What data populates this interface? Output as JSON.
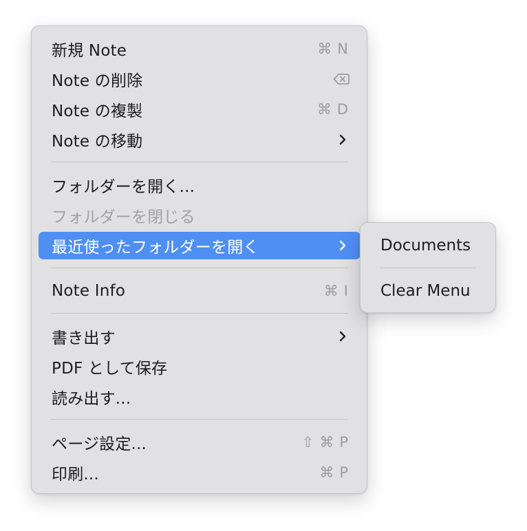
{
  "menu": {
    "items": {
      "new_note": {
        "label": "新規 Note",
        "shortcut_mod": "⌘",
        "shortcut_key": "N"
      },
      "delete_note": {
        "label": "Note の削除",
        "shortcut_icon": "delete-backward-icon"
      },
      "duplicate_note": {
        "label": "Note の複製",
        "shortcut_mod": "⌘",
        "shortcut_key": "D"
      },
      "move_note": {
        "label": "Note の移動",
        "submenu_icon": "chevron-right-icon"
      },
      "open_folder": {
        "label": "フォルダーを開く..."
      },
      "close_folder": {
        "label": "フォルダーを閉じる",
        "disabled": true
      },
      "recent_folders": {
        "label": "最近使ったフォルダーを開く",
        "submenu_icon": "chevron-right-icon",
        "highlighted": true
      },
      "note_info": {
        "label": "Note Info",
        "shortcut_mod": "⌘",
        "shortcut_key": "I"
      },
      "export": {
        "label": "書き出す",
        "submenu_icon": "chevron-right-icon"
      },
      "save_pdf": {
        "label": "PDF として保存"
      },
      "import": {
        "label": "読み出す..."
      },
      "page_setup": {
        "label": "ページ設定...",
        "shortcut_shift": "⇧",
        "shortcut_mod": "⌘",
        "shortcut_key": "P"
      },
      "print": {
        "label": "印刷...",
        "shortcut_mod": "⌘",
        "shortcut_key": "P"
      }
    }
  },
  "submenu": {
    "items": {
      "documents": {
        "label": "Documents"
      },
      "clear_menu": {
        "label": "Clear Menu"
      }
    }
  },
  "colors": {
    "menu_background": "#e1e1e3",
    "highlight": "#4f8ff3",
    "text": "#1d1d1f",
    "disabled_text": "#a2a2a6",
    "shortcut_text": "#9d9da1",
    "separator": "#c4c4c8"
  }
}
